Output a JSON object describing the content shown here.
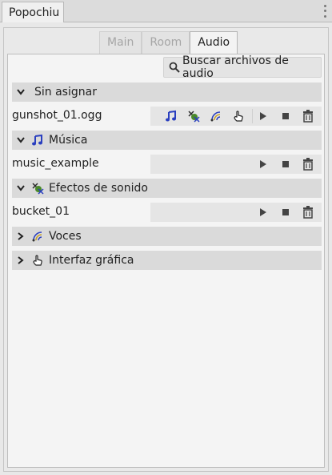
{
  "dock": {
    "tab_label": "Popochiu"
  },
  "tabs": [
    {
      "label": "Main",
      "active": false
    },
    {
      "label": "Room",
      "active": false
    },
    {
      "label": "Audio",
      "active": true
    }
  ],
  "search": {
    "label": "Buscar archivos de audio",
    "icon": "search-icon"
  },
  "groups": [
    {
      "label": "Sin asignar",
      "expanded": true,
      "icon": ""
    },
    {
      "label": "Música",
      "expanded": true,
      "icon": "music-note-icon"
    },
    {
      "label": "Efectos de sonido",
      "expanded": true,
      "icon": "sound-effect-icon"
    },
    {
      "label": "Voces",
      "expanded": false,
      "icon": "voice-icon"
    },
    {
      "label": "Interfaz gráfica",
      "expanded": false,
      "icon": "hand-pointer-icon"
    }
  ],
  "files": [
    {
      "name": "gunshot_01.ogg",
      "group": "Sin asignar",
      "assign_icons": [
        "music-note-icon",
        "sound-effect-icon",
        "voice-icon",
        "hand-pointer-icon"
      ]
    },
    {
      "name": "music_example",
      "group": "Música"
    },
    {
      "name": "bucket_01",
      "group": "Efectos de sonido"
    }
  ],
  "colors": {
    "accent_blue": "#2a3fbf",
    "effect_green": "#4a8a2a",
    "voice_gold": "#c9a227"
  }
}
